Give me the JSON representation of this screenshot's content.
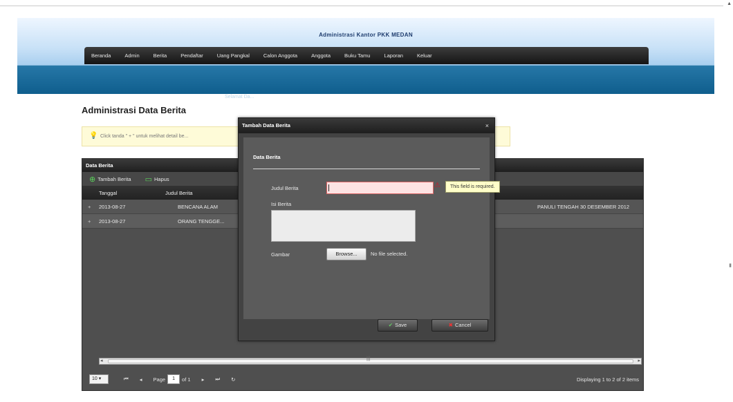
{
  "header": {
    "site_title": "Administrasi Kantor PKK MEDAN",
    "welcome": "Selamat Da..."
  },
  "menu": {
    "items": [
      "Beranda",
      "Admin",
      "Berita",
      "Pendaftar",
      "Uang Pangkal",
      "Calon Anggota",
      "Anggota",
      "Buku Tamu",
      "Laporan",
      "Keluar"
    ]
  },
  "page": {
    "title": "Administrasi Data Berita",
    "info": "Click tanda \" + \" untuk melihat detail be..."
  },
  "grid": {
    "title": "Data Berita",
    "toolbar": {
      "add_label": "Tambah Berita",
      "delete_label": "Hapus"
    },
    "columns": [
      "Tanggal",
      "Judul Berita"
    ],
    "rows": [
      {
        "expand": "+",
        "tanggal": "2013-08-27",
        "judul": "BENCANA ALAM",
        "extra": "PANULI TENGAH 30 DESEMBER 2012"
      },
      {
        "expand": "+",
        "tanggal": "2013-08-27",
        "judul": "ORANG TENGGE...",
        "extra": ""
      }
    ],
    "pager": {
      "page_size": "10",
      "page_label": "Page",
      "page_value": "1",
      "of_label": "of 1",
      "display": "Displaying 1 to 2 of 2 items"
    }
  },
  "modal": {
    "title": "Tambah Data Berita",
    "close": "×",
    "section": "Data Berita",
    "fields": {
      "judul_label": "Judul Berita",
      "judul_value": "",
      "error_tooltip": "This field is required.",
      "isi_label": "Isi Berita",
      "isi_value": "",
      "gambar_label": "Gambar",
      "browse_label": "Browse...",
      "no_file": "No file selected."
    },
    "buttons": {
      "save": "Save",
      "cancel": "Cancel"
    }
  }
}
